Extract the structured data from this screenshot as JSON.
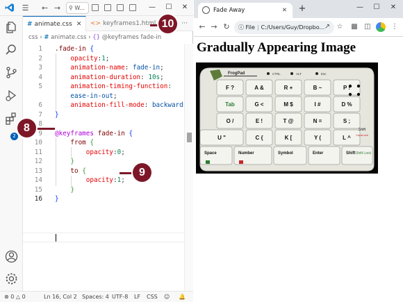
{
  "vscode": {
    "search_text": "W...",
    "tabs": [
      {
        "label": "animate.css",
        "active": true
      },
      {
        "label": "keyframes1.html",
        "active": false
      }
    ],
    "tabs_more": "···",
    "breadcrumb": {
      "folder": "css",
      "file": "animate.css",
      "symbol": "@keyframes fade-in"
    },
    "extensions_badge": "2",
    "code_lines": [
      {
        "n": "1",
        "tokens": [
          {
            "t": ".fade-in",
            "c": "sel"
          },
          {
            "t": " ",
            "c": "txt"
          },
          {
            "t": "{",
            "c": "br-y"
          }
        ]
      },
      {
        "n": "2",
        "tokens": [
          {
            "t": "    ",
            "c": "txt"
          },
          {
            "t": "opacity",
            "c": "prop"
          },
          {
            "t": ":",
            "c": "txt"
          },
          {
            "t": "1",
            "c": "num"
          },
          {
            "t": ";",
            "c": "txt"
          }
        ]
      },
      {
        "n": "3",
        "tokens": [
          {
            "t": "    ",
            "c": "txt"
          },
          {
            "t": "animation-name",
            "c": "prop"
          },
          {
            "t": ": ",
            "c": "txt"
          },
          {
            "t": "fade-in",
            "c": "val"
          },
          {
            "t": ";",
            "c": "txt"
          }
        ]
      },
      {
        "n": "4",
        "tokens": [
          {
            "t": "    ",
            "c": "txt"
          },
          {
            "t": "animation-duration",
            "c": "prop"
          },
          {
            "t": ": ",
            "c": "txt"
          },
          {
            "t": "10s",
            "c": "num"
          },
          {
            "t": ";",
            "c": "txt"
          }
        ]
      },
      {
        "n": "5",
        "tokens": [
          {
            "t": "    ",
            "c": "txt"
          },
          {
            "t": "animation-timing-function",
            "c": "prop"
          },
          {
            "t": ":",
            "c": "txt"
          }
        ]
      },
      {
        "n": "",
        "tokens": [
          {
            "t": "    ",
            "c": "txt"
          },
          {
            "t": "ease-in-out",
            "c": "val"
          },
          {
            "t": ";",
            "c": "txt"
          }
        ]
      },
      {
        "n": "6",
        "tokens": [
          {
            "t": "    ",
            "c": "txt"
          },
          {
            "t": "animation-fill-mode",
            "c": "prop"
          },
          {
            "t": ": ",
            "c": "txt"
          },
          {
            "t": "backwards",
            "c": "val"
          },
          {
            "t": ";",
            "c": "txt"
          }
        ]
      },
      {
        "n": "7",
        "tokens": [
          {
            "t": "}",
            "c": "br-y"
          }
        ]
      },
      {
        "n": "8",
        "tokens": []
      },
      {
        "n": "9",
        "tokens": [
          {
            "t": "@keyframes",
            "c": "at"
          },
          {
            "t": " ",
            "c": "txt"
          },
          {
            "t": "fade-in",
            "c": "sel"
          },
          {
            "t": " ",
            "c": "txt"
          },
          {
            "t": "{",
            "c": "br-y"
          }
        ]
      },
      {
        "n": "10",
        "tokens": [
          {
            "t": "    ",
            "c": "txt"
          },
          {
            "t": "from",
            "c": "sel"
          },
          {
            "t": " ",
            "c": "txt"
          },
          {
            "t": "{",
            "c": "br-p"
          }
        ]
      },
      {
        "n": "11",
        "tokens": [
          {
            "t": "        ",
            "c": "txt"
          },
          {
            "t": "opacity",
            "c": "prop"
          },
          {
            "t": ":",
            "c": "txt"
          },
          {
            "t": "0",
            "c": "num"
          },
          {
            "t": ";",
            "c": "txt"
          }
        ]
      },
      {
        "n": "12",
        "tokens": [
          {
            "t": "    ",
            "c": "txt"
          },
          {
            "t": "}",
            "c": "br-p"
          }
        ]
      },
      {
        "n": "13",
        "tokens": [
          {
            "t": "    ",
            "c": "txt"
          },
          {
            "t": "to",
            "c": "sel"
          },
          {
            "t": " ",
            "c": "txt"
          },
          {
            "t": "{",
            "c": "br-p"
          }
        ]
      },
      {
        "n": "14",
        "tokens": [
          {
            "t": "        ",
            "c": "txt"
          },
          {
            "t": "opacity",
            "c": "prop"
          },
          {
            "t": ":",
            "c": "txt"
          },
          {
            "t": "1",
            "c": "num"
          },
          {
            "t": ";",
            "c": "txt"
          }
        ]
      },
      {
        "n": "15",
        "tokens": [
          {
            "t": "    ",
            "c": "txt"
          },
          {
            "t": "}",
            "c": "br-p"
          }
        ]
      },
      {
        "n": "16",
        "tokens": [
          {
            "t": "}",
            "c": "br-y"
          }
        ]
      }
    ],
    "current_line": "16",
    "status": {
      "errors": "0",
      "warnings": "0",
      "position": "Ln 16, Col 2",
      "spaces": "Spaces: 4",
      "encoding": "UTF-8",
      "eol": "LF",
      "language": "CSS"
    }
  },
  "callouts": [
    "8",
    "9",
    "10"
  ],
  "browser": {
    "tab_title": "Fade Away",
    "new_tab": "+",
    "info_label": "File",
    "address": "C:/Users/Guy/Dropbo...",
    "page_heading": "Gradually Appearing Image"
  },
  "photo": {
    "brand": "FrogPad",
    "header_keys": [
      "CTRL",
      "ALT",
      "Esc"
    ],
    "keys": [
      [
        "F ?",
        "A &",
        "R +",
        "B ~",
        "P !"
      ],
      [
        "Tab",
        "G <",
        "M $",
        "I #",
        "D %"
      ],
      [
        "O /",
        "E !",
        "T @",
        "N =",
        "S ;"
      ],
      [
        "U \"",
        "C {",
        "K [",
        "Y (",
        "L ^"
      ],
      [
        "Space",
        "Number",
        "Symbol",
        "Enter",
        "Shift"
      ]
    ],
    "side_labels": [
      "Shift",
      "CapsLock",
      "Shift Lock"
    ]
  },
  "colors": {
    "callout": "#7d1728",
    "vscode_accent": "#005fb8",
    "css_selector": "#800000",
    "css_property": "#e50000",
    "css_value": "#0451a5",
    "css_at_rule": "#af00db"
  }
}
